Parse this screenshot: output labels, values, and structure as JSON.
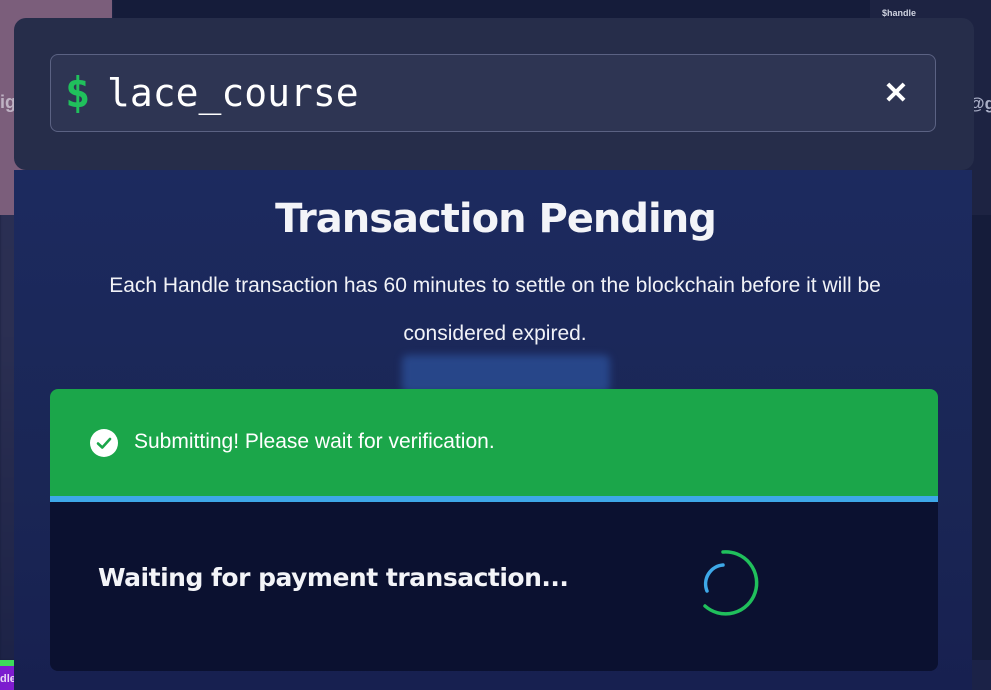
{
  "background": {
    "left_label": "ig",
    "right_tag": "$handle",
    "right_label": "@g",
    "bottom_label": "dle"
  },
  "search": {
    "prefix_icon": "dollar-icon",
    "value": "lace_course",
    "clear_icon": "close-icon"
  },
  "title": "Transaction Pending",
  "description": "Each Handle transaction has 60 minutes to settle on the blockchain before it will be considered expired.",
  "status": {
    "banner_text": "Submitting! Please wait for verification.",
    "banner_icon": "check-circle-icon",
    "waiting_text": "Waiting for payment transaction...",
    "spinner_icon": "loading-spinner-icon"
  },
  "colors": {
    "accent_green": "#1ba64a",
    "dollar_green": "#20c05c",
    "progress_blue": "#3ea8e8",
    "panel_dark": "#0b1130"
  }
}
